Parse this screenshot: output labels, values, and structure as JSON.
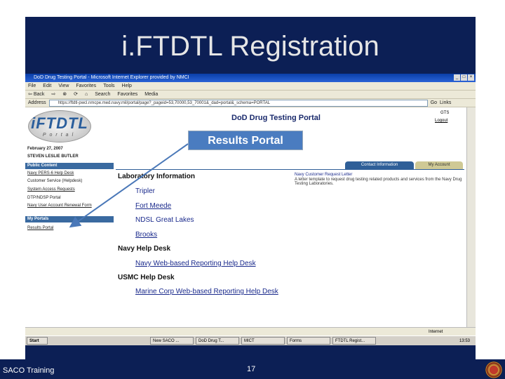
{
  "slide": {
    "title": "i.FTDTL Registration",
    "footer_left": "SACO Training",
    "page_number": "17"
  },
  "browser": {
    "window_title": "DoD Drug Testing Portal - Microsoft Internet Explorer provided by NMCI",
    "menu": [
      "File",
      "Edit",
      "View",
      "Favorites",
      "Tools",
      "Help"
    ],
    "toolbar": [
      "Back",
      "Search",
      "Favorites",
      "Media"
    ],
    "address_label": "Address",
    "address": "https://ftdtl-pwcl.nmcpe.med.navy.mil/portal/page?_pageid=53,70000,53_70001&_dad=portal&_schema=PORTAL",
    "go_label": "Go",
    "links_label": "Links",
    "status_zone": "Internet"
  },
  "portal": {
    "logo_main": "iFTDTL",
    "logo_sub": "Portal",
    "header": "DoD Drug Testing Portal",
    "top_right": "GTS",
    "logout": "Logout",
    "date": "February 27, 2007",
    "user": "STEVEN LESLIE BUTLER",
    "public_content": "Public Content",
    "public_links": [
      "Navy PERS-6 Help Desk",
      "Customer Service (Helpdesk)",
      "System Access Requests",
      "DTP/NDSP Portal",
      "Navy User Account Renewal Form"
    ],
    "my_portals": "My Portals",
    "results_portal": "Results Portal",
    "tabs": [
      "Contact Information",
      "My Account"
    ],
    "lab_heading": "Laboratory Information",
    "labs": [
      "Tripler",
      "Fort Meede",
      "NDSL Great Lakes",
      "Brooks"
    ],
    "navy_help": "Navy Help Desk",
    "navy_help_link": "Navy Web-based Reporting Help Desk",
    "usmc_help": "USMC Help Desk",
    "usmc_help_link": "Marine Corp Web-based Reporting Help Desk",
    "letter_title": "Navy Customer Request Letter",
    "letter_desc": "A letter template to request drug testing related products and services from the Navy Drug Testing Laboratories."
  },
  "callout": "Results Portal",
  "taskbar": {
    "start": "Start",
    "items": [
      "New SACO ...",
      "DoD Drug T...",
      "MICT",
      "Forms",
      "FTDTL Regist..."
    ],
    "clock": "13:53"
  }
}
